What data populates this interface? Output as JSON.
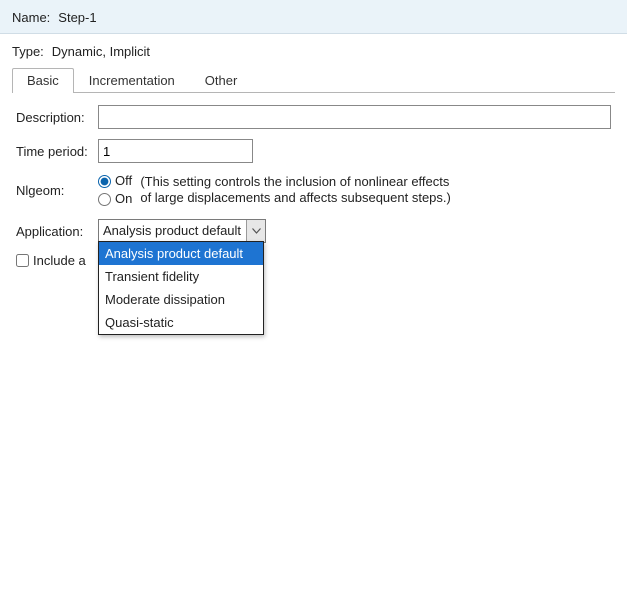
{
  "header": {
    "name_label": "Name:",
    "name_value": "Step-1",
    "type_label": "Type:",
    "type_value": "Dynamic, Implicit"
  },
  "tabs": {
    "basic": "Basic",
    "incrementation": "Incrementation",
    "other": "Other"
  },
  "basic": {
    "description_label": "Description:",
    "description_value": "",
    "time_period_label": "Time period:",
    "time_period_value": "1",
    "nlgeom_label": "Nlgeom:",
    "nlgeom_off": "Off",
    "nlgeom_on": "On",
    "nlgeom_note_line1": "(This setting controls the inclusion of nonlinear effects",
    "nlgeom_note_line2": "of large displacements and affects subsequent steps.)",
    "application_label": "Application:",
    "application_selected": "Analysis product default",
    "application_options": {
      "opt0": "Analysis product default",
      "opt1": "Transient fidelity",
      "opt2": "Moderate dissipation",
      "opt3": "Quasi-static"
    },
    "include_adiabatic_label": "Include adiabatic heating effects",
    "include_adiabatic_visible_fragment": "Include a"
  }
}
